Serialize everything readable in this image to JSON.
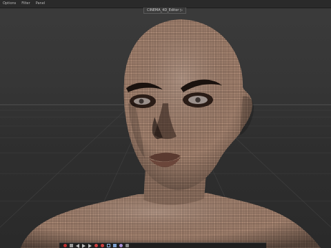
{
  "menu": {
    "items": [
      {
        "label": "Options"
      },
      {
        "label": "Filter"
      },
      {
        "label": "Panel"
      }
    ]
  },
  "viewport": {
    "camera_label": "CINEMA_4D_Editor ▷"
  },
  "toolbar": {
    "icons": [
      "record-icon",
      "stop-icon",
      "play-back-icon",
      "play-icon",
      "play-forward-icon",
      "key-icon",
      "key-icon",
      "grid-icon",
      "cube-icon",
      "sphere-icon",
      "settings-icon"
    ]
  },
  "colors": {
    "skin": "#b99a86",
    "wire": "#3a2a22",
    "floor_grid": "#4a4a4a",
    "background": "#363636"
  }
}
